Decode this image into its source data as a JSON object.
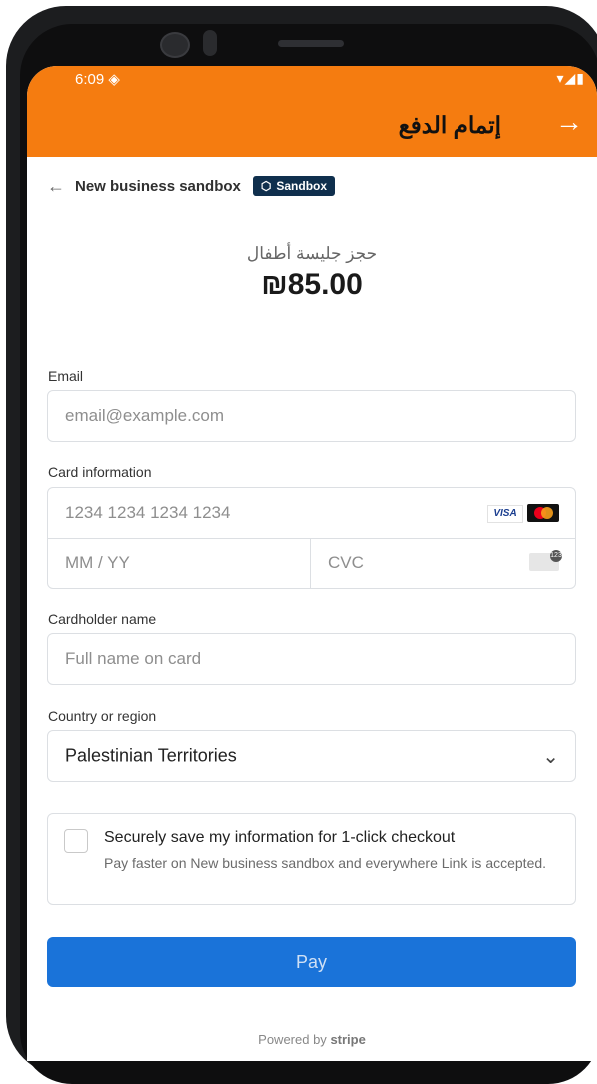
{
  "status_bar": {
    "time": "6:09 ◈",
    "icons": "▾◢▮"
  },
  "app_bar": {
    "title": "إتمام الدفع",
    "forward_icon": "arrow-right-icon"
  },
  "merchant": {
    "back_icon": "arrow-left-icon",
    "name": "New business sandbox",
    "badge": "Sandbox"
  },
  "product": {
    "name": "حجز جليسة أطفال",
    "amount": "₪85.00"
  },
  "email": {
    "label": "Email",
    "placeholder": "email@example.com"
  },
  "card": {
    "label": "Card information",
    "number_placeholder": "1234 1234 1234 1234",
    "brand_visa": "VISA",
    "expiry_placeholder": "MM / YY",
    "cvc_placeholder": "CVC",
    "cvc_badge": "123"
  },
  "cardholder": {
    "label": "Cardholder name",
    "placeholder": "Full name on card"
  },
  "country": {
    "label": "Country or region",
    "value": "Palestinian Territories"
  },
  "link": {
    "title": "Securely save my information for 1-click checkout",
    "description": "Pay faster on New business sandbox and everywhere Link is accepted."
  },
  "pay_button": {
    "label": "Pay",
    "color": "#1a73d9"
  },
  "footer": {
    "powered_by": "Powered by",
    "brand": "stripe"
  },
  "colors": {
    "app_bar": "#f57c10",
    "badge": "#0f2f4d"
  }
}
